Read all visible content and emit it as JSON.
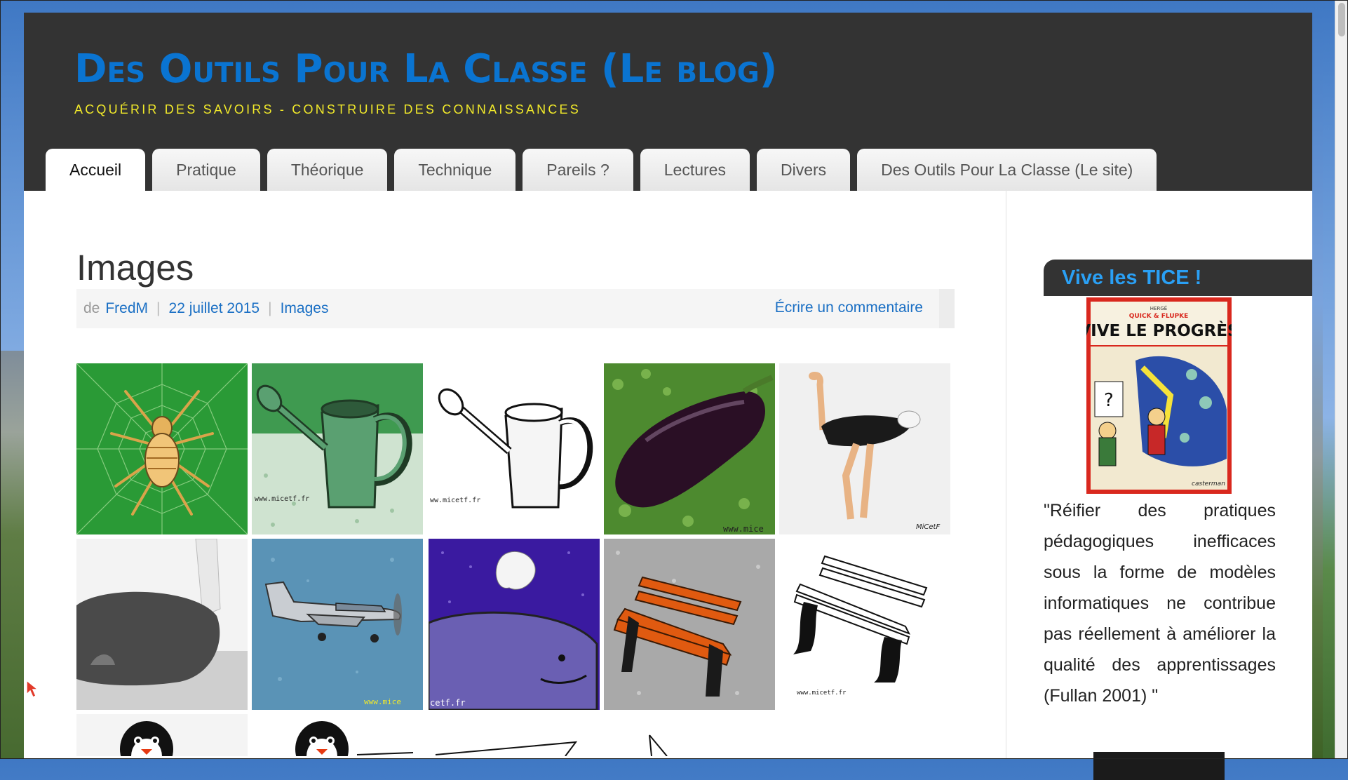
{
  "site": {
    "title": "Des Outils Pour La Classe (Le blog)",
    "tagline": "Acquérir des savoirs - Construire des connaissances"
  },
  "nav": {
    "items": [
      {
        "label": "Accueil",
        "active": true
      },
      {
        "label": "Pratique"
      },
      {
        "label": "Théorique"
      },
      {
        "label": "Technique"
      },
      {
        "label": "Pareils ?"
      },
      {
        "label": "Lectures"
      },
      {
        "label": "Divers"
      },
      {
        "label": "Des Outils Pour La Classe (Le site)"
      }
    ]
  },
  "post": {
    "title": "Images",
    "meta": {
      "by": "de",
      "author": "FredM",
      "date": "22 juillet 2015",
      "category": "Images",
      "comment_link": "Écrire un commentaire"
    },
    "gallery": {
      "thumbnails": [
        {
          "subject": "spider-icon",
          "caption": ""
        },
        {
          "subject": "watering-can-green-icon",
          "caption": "www.micetf.fr"
        },
        {
          "subject": "watering-can-outline-icon",
          "caption": "ww.micetf.fr"
        },
        {
          "subject": "eggplant-icon",
          "caption": "www.mice"
        },
        {
          "subject": "ostrich-icon",
          "caption": "MiCetF"
        },
        {
          "subject": "ostrich-grey-icon",
          "caption": ""
        },
        {
          "subject": "airplane-icon",
          "caption": "www.mice"
        },
        {
          "subject": "whale-icon",
          "caption": "cetf.fr"
        },
        {
          "subject": "bench-orange-icon",
          "caption": ""
        },
        {
          "subject": "bench-outline-icon",
          "caption": "www.micetf.fr"
        },
        {
          "subject": "penguin-icon",
          "caption": ""
        },
        {
          "subject": "penguin-icon",
          "caption": ""
        },
        {
          "subject": "paper-plane-icon",
          "caption": ""
        },
        {
          "subject": "paper-plane-icon",
          "caption": ""
        }
      ]
    }
  },
  "sidebar": {
    "widget_title": "Vive les TICE !",
    "cover": {
      "publisher": "HERGÉ",
      "series": "QUICK & FLUPKE",
      "title": "VIVE LE PROGRÈS",
      "imprint": "casterman"
    },
    "quote": "\"Réifier des pratiques pédagogiques inefficaces sous la forme de modèles informatiques ne contribue pas réellement à améliorer la qualité des apprentissages (Fullan 2001) \""
  },
  "colors": {
    "header_bg": "#333333",
    "title_blue": "#0a74d1",
    "tagline_yellow": "#f1e92a",
    "link_blue": "#1a6fc4",
    "widget_title_blue": "#2aa0f5"
  }
}
